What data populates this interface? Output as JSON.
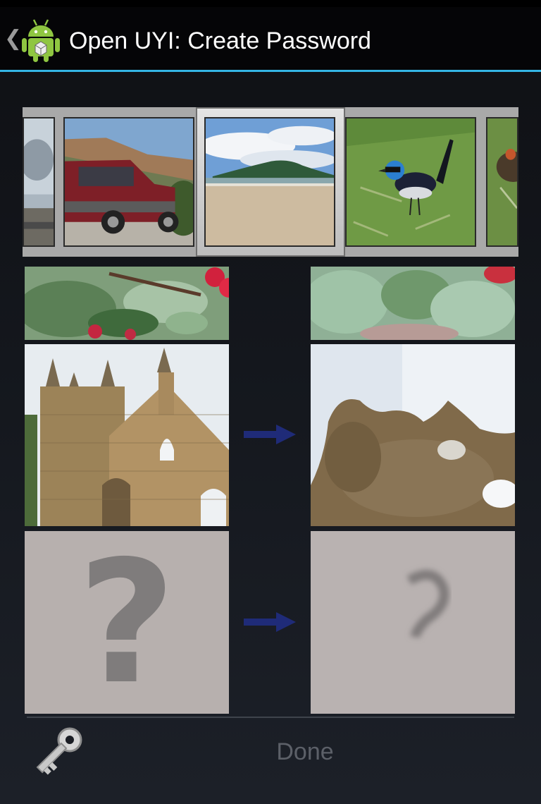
{
  "action_bar": {
    "title": "Open UYI: Create Password",
    "up_icon": "chevron-left-icon",
    "app_icon": "android-robot-icon"
  },
  "carousel": {
    "items": [
      "partial-image-left",
      "red-car",
      "beach-headland",
      "blue-wren-bird",
      "partial-bird-right"
    ],
    "selected_index": 2
  },
  "grid": {
    "rows": [
      {
        "left": "flowers-photo",
        "right": "flowers-blurred",
        "arrow": false
      },
      {
        "left": "church-ruin-photo",
        "right": "church-distorted",
        "arrow": true
      },
      {
        "left": "question-mark-placeholder",
        "right": "question-mark-distorted",
        "arrow": true
      }
    ],
    "placeholder_glyph": "?"
  },
  "footer": {
    "key_icon": "key-icon",
    "done_label": "Done"
  },
  "colors": {
    "accent": "#34b5e5",
    "arrow": "#1f2b78",
    "placeholder_bg": "#b7b0ae",
    "done_text": "#5c6068"
  }
}
